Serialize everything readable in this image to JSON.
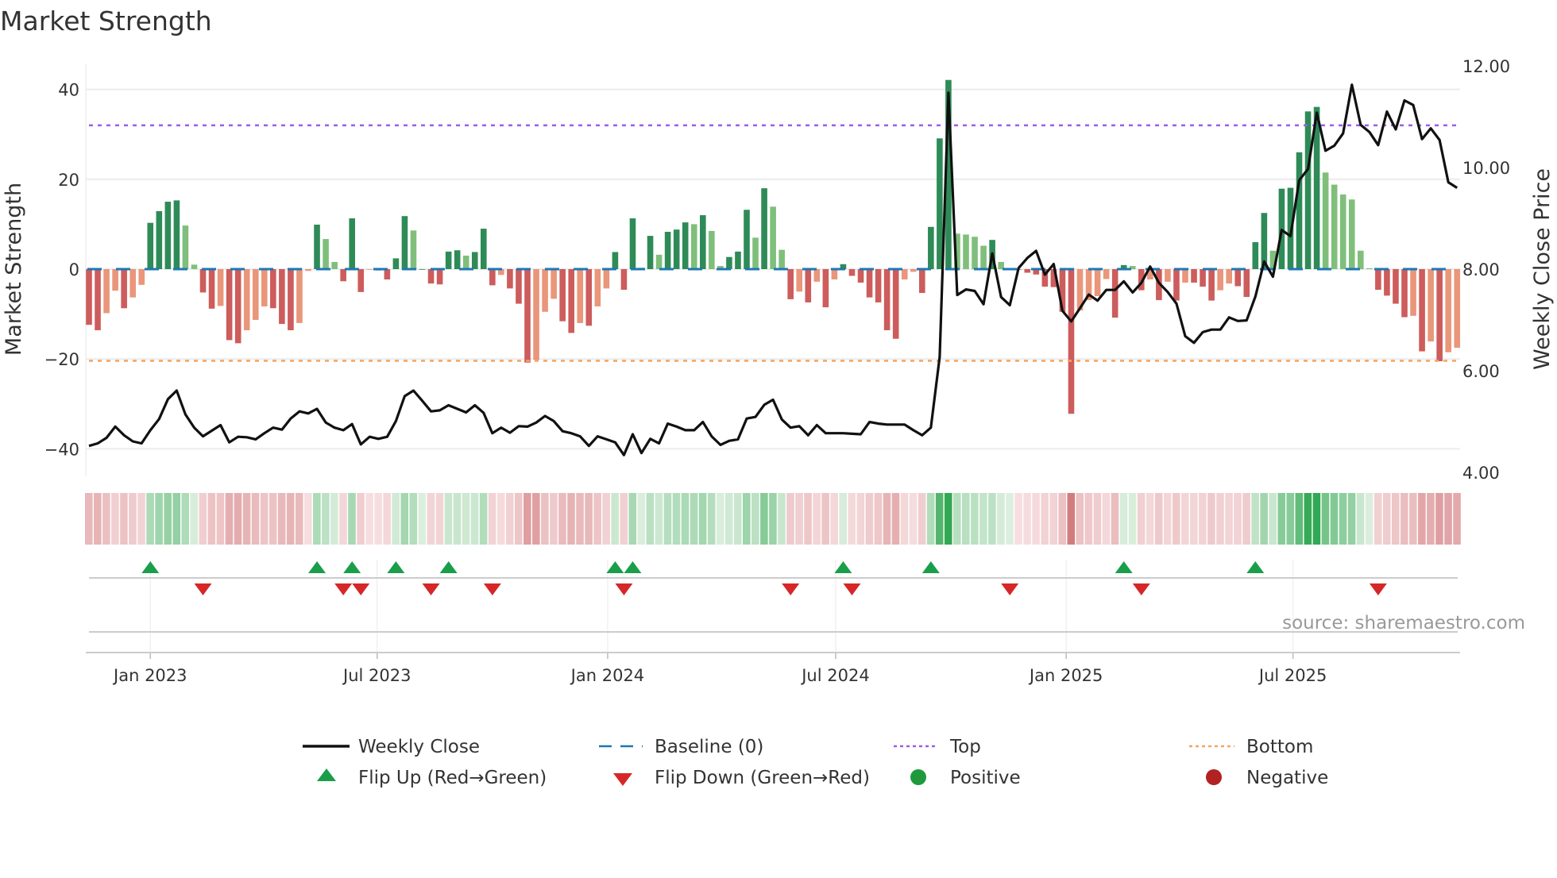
{
  "chart_data": {
    "type": "bar+line",
    "title": "Market Strength",
    "ylabel_left": "Market Strength",
    "ylabel_right": "Weekly Close Price",
    "x_start_week": "2022-11-13",
    "x_interval_days": 7,
    "xticks": [
      {
        "label": "Jan 2023",
        "date": "2023-01-01"
      },
      {
        "label": "Jul 2023",
        "date": "2023-07-01"
      },
      {
        "label": "Jan 2024",
        "date": "2024-01-01"
      },
      {
        "label": "Jul 2024",
        "date": "2024-07-01"
      },
      {
        "label": "Jan 2025",
        "date": "2025-01-01"
      },
      {
        "label": "Jul 2025",
        "date": "2025-07-01"
      }
    ],
    "ylim_left": [
      -44,
      46
    ],
    "yticks_left": [
      {
        "v": 40,
        "label": "40"
      },
      {
        "v": 20,
        "label": "20"
      },
      {
        "v": 0,
        "label": "0"
      },
      {
        "v": -20,
        "label": "−20"
      },
      {
        "v": -40,
        "label": "−40"
      }
    ],
    "yticks_right": [
      {
        "v": 12,
        "label": "12.00"
      },
      {
        "v": 10,
        "label": "10.00"
      },
      {
        "v": 8,
        "label": "8.00"
      },
      {
        "v": 6,
        "label": "6.00"
      },
      {
        "v": 4,
        "label": "4.00"
      }
    ],
    "top_threshold": 32,
    "bottom_threshold": -20.4,
    "baseline": 0,
    "strength": [
      -12.4,
      -13.6,
      -9.8,
      -4.8,
      -8.7,
      -6.3,
      -3.5,
      10.3,
      12.9,
      15.0,
      15.3,
      9.7,
      1.0,
      -5.2,
      -8.8,
      -8.2,
      -15.8,
      -16.5,
      -13.6,
      -11.3,
      -8.3,
      -8.7,
      -12.2,
      -13.6,
      -12.0,
      -0.4,
      9.9,
      6.7,
      1.6,
      -2.7,
      11.3,
      -5.1,
      -0.1,
      -0.3,
      -2.3,
      2.4,
      11.8,
      8.6,
      0.0,
      -3.2,
      -3.4,
      3.9,
      4.2,
      3.0,
      3.8,
      9.0,
      -3.6,
      -1.3,
      -4.3,
      -7.7,
      -20.8,
      -20.2,
      -9.5,
      -6.6,
      -11.6,
      -14.2,
      -12.0,
      -12.6,
      -8.3,
      -4.3,
      3.8,
      -4.6,
      11.3,
      0.3,
      7.4,
      3.2,
      8.3,
      8.8,
      10.4,
      10.0,
      12.0,
      8.5,
      0.7,
      2.7,
      3.9,
      13.2,
      7.0,
      18.0,
      13.9,
      4.3,
      -6.7,
      -5.0,
      -7.4,
      -2.8,
      -8.5,
      -2.3,
      1.1,
      -1.5,
      -3.0,
      -6.3,
      -7.4,
      -13.6,
      -15.5,
      -2.3,
      -0.6,
      -5.3,
      9.4,
      29.1,
      42.1,
      7.9,
      7.7,
      7.2,
      5.2,
      6.5,
      1.6,
      0.0,
      -0.1,
      -0.8,
      -1.2,
      -3.9,
      -4.0,
      -9.5,
      -32.2,
      -9.2,
      -6.9,
      -6.0,
      -2.2,
      -10.8,
      0.9,
      0.7,
      -4.7,
      -2.3,
      -6.9,
      -2.8,
      -7.0,
      -3.0,
      -3.0,
      -3.9,
      -7.0,
      -4.7,
      -3.2,
      -3.8,
      -6.2,
      6.0,
      12.5,
      4.1,
      17.9,
      18.1,
      26.0,
      35.1,
      36.1,
      21.5,
      18.8,
      16.6,
      15.5,
      4.1,
      0.2,
      -4.6,
      -5.9,
      -7.7,
      -10.7,
      -10.4,
      -18.3,
      -16.1,
      -20.5,
      -18.5,
      -17.5
    ],
    "weekly_close": [
      4.52,
      4.57,
      4.68,
      4.9,
      4.73,
      4.61,
      4.57,
      4.83,
      5.05,
      5.44,
      5.61,
      5.14,
      4.88,
      4.71,
      4.82,
      4.93,
      4.59,
      4.7,
      4.69,
      4.65,
      4.77,
      4.88,
      4.84,
      5.06,
      5.2,
      5.16,
      5.25,
      4.98,
      4.88,
      4.83,
      4.95,
      4.55,
      4.7,
      4.66,
      4.7,
      5.01,
      5.5,
      5.61,
      5.41,
      5.2,
      5.22,
      5.32,
      5.25,
      5.18,
      5.32,
      5.17,
      4.77,
      4.88,
      4.78,
      4.91,
      4.9,
      4.98,
      5.11,
      5.01,
      4.81,
      4.77,
      4.71,
      4.52,
      4.71,
      4.65,
      4.59,
      4.34,
      4.75,
      4.38,
      4.66,
      4.57,
      4.96,
      4.9,
      4.83,
      4.83,
      4.99,
      4.71,
      4.54,
      4.62,
      4.65,
      5.06,
      5.09,
      5.33,
      5.43,
      5.04,
      4.88,
      4.91,
      4.73,
      4.93,
      4.77,
      4.77,
      4.77,
      4.76,
      4.75,
      4.99,
      4.96,
      4.94,
      4.94,
      4.94,
      4.83,
      4.73,
      4.88,
      6.27,
      11.47,
      7.49,
      7.6,
      7.57,
      7.31,
      8.31,
      7.45,
      7.29,
      8.02,
      8.22,
      8.36,
      7.89,
      8.1,
      7.18,
      6.97,
      7.23,
      7.5,
      7.38,
      7.59,
      7.59,
      7.76,
      7.54,
      7.73,
      8.05,
      7.73,
      7.55,
      7.32,
      6.68,
      6.55,
      6.76,
      6.81,
      6.81,
      7.05,
      6.98,
      6.99,
      7.46,
      8.15,
      7.85,
      8.77,
      8.65,
      9.75,
      9.97,
      11.08,
      10.33,
      10.43,
      10.67,
      11.63,
      10.84,
      10.7,
      10.44,
      11.1,
      10.75,
      11.32,
      11.23,
      10.56,
      10.77,
      10.54,
      9.71,
      9.6
    ],
    "flip_up_weeks": [
      8,
      27,
      31,
      36,
      42,
      61,
      63,
      87,
      97,
      119,
      134
    ],
    "flip_down_weeks": [
      14,
      30,
      32,
      40,
      47,
      62,
      81,
      88,
      106,
      121,
      148
    ],
    "legend": {
      "weekly_close": "Weekly Close",
      "baseline": "Baseline (0)",
      "top": "Top",
      "bottom": "Bottom",
      "flip_up": "Flip Up (Red→Green)",
      "flip_down": "Flip Down (Green→Red)",
      "positive": "Positive",
      "negative": "Negative"
    },
    "source": "source: sharemaestro.com"
  },
  "colors": {
    "pos_strong": "#2e8b57",
    "pos_weak": "#7fbf7b",
    "neg_strong": "#cd5c5c",
    "neg_weak": "#e9967a",
    "baseline": "#1f77b4",
    "top": "#9b5de5",
    "bottom": "#f4a460",
    "line": "#111111",
    "flip_up": "#1a9e4a",
    "flip_down": "#d62728",
    "positive": "#1e9a3c",
    "negative": "#b22222"
  }
}
